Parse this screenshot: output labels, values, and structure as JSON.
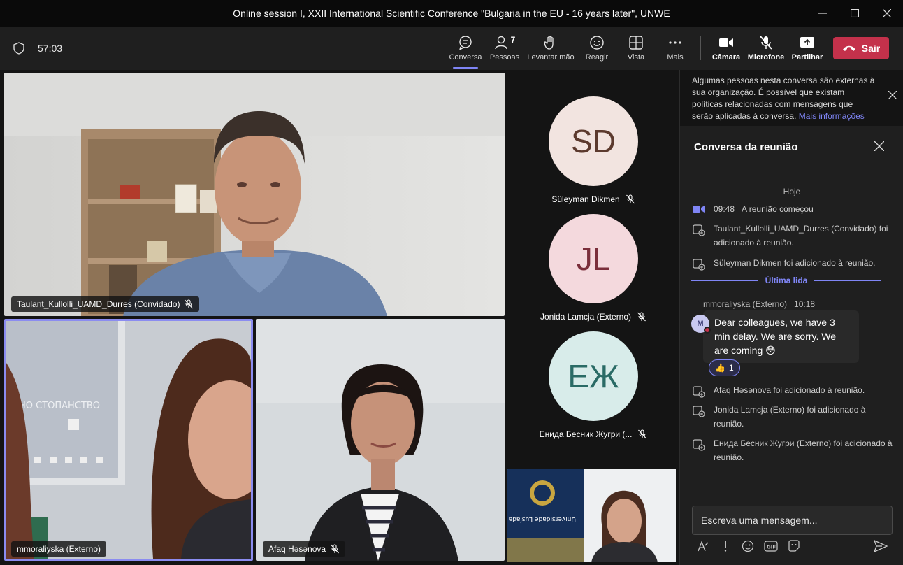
{
  "window": {
    "title": "Online session I, XXII International Scientific Conference \"Bulgaria in the EU - 16 years later\", UNWE"
  },
  "toolbar": {
    "timer": "57:03",
    "buttons": [
      {
        "label": "Conversa",
        "icon": "chat-icon",
        "active": true
      },
      {
        "label": "Pessoas",
        "icon": "people-icon",
        "badge": "7"
      },
      {
        "label": "Levantar mão",
        "icon": "raise-hand-icon"
      },
      {
        "label": "Reagir",
        "icon": "react-icon"
      },
      {
        "label": "Vista",
        "icon": "view-icon"
      },
      {
        "label": "Mais",
        "icon": "more-icon"
      },
      {
        "label": "Câmara",
        "icon": "camera-icon"
      },
      {
        "label": "Microfone",
        "icon": "mic-off-icon"
      },
      {
        "label": "Partilhar",
        "icon": "share-icon"
      }
    ],
    "leave_label": "Sair"
  },
  "participants": {
    "video_tiles": [
      {
        "name": "Taulant_Kullolli_UAMD_Durres (Convidado)"
      },
      {
        "name": "mmoraliyska (Externo)"
      },
      {
        "name": "Afaq Həsənova"
      }
    ],
    "avatar_tiles": [
      {
        "initials": "SD",
        "name": "Süleyman Dikmen",
        "bg": "#f2e4e0",
        "fg": "#5c3a2e"
      },
      {
        "initials": "JL",
        "name": "Jonida Lamcja (Externo)",
        "bg": "#f4d9dd",
        "fg": "#7a2f3b"
      },
      {
        "initials": "ЕЖ",
        "name": "Енида Бесник Жугри (...",
        "bg": "#d8ecea",
        "fg": "#2a6b66"
      }
    ]
  },
  "chat": {
    "banner_text": "Algumas pessoas nesta conversa são externas à sua organização. É possível que existam políticas relacionadas com mensagens que serão aplicadas à conversa.",
    "banner_link": "Mais informações",
    "header": "Conversa da reunião",
    "date_label": "Hoje",
    "events": [
      {
        "time": "09:48",
        "text": "A reunião começou"
      },
      {
        "text": "Taulant_Kullolli_UAMD_Durres (Convidado) foi adicionado à reunião."
      },
      {
        "text": "Süleyman Dikmen foi adicionado à reunião."
      },
      {
        "text": "Afaq Həsənova foi adicionado à reunião."
      },
      {
        "text": "Jonida Lamcja (Externo) foi adicionado à reunião."
      },
      {
        "text": "Енида Бесник Жугри (Externo) foi adicionado à reunião."
      }
    ],
    "last_read_label": "Última lida",
    "message": {
      "author": "mmoraliyska (Externo)",
      "time": "10:18",
      "avatar_initial": "M",
      "text": "Dear colleagues, we have 3 min delay. We are sorry. We are coming 😳",
      "reaction_emoji": "👍",
      "reaction_count": "1"
    },
    "compose_placeholder": "Escreva uma mensagem..."
  }
}
